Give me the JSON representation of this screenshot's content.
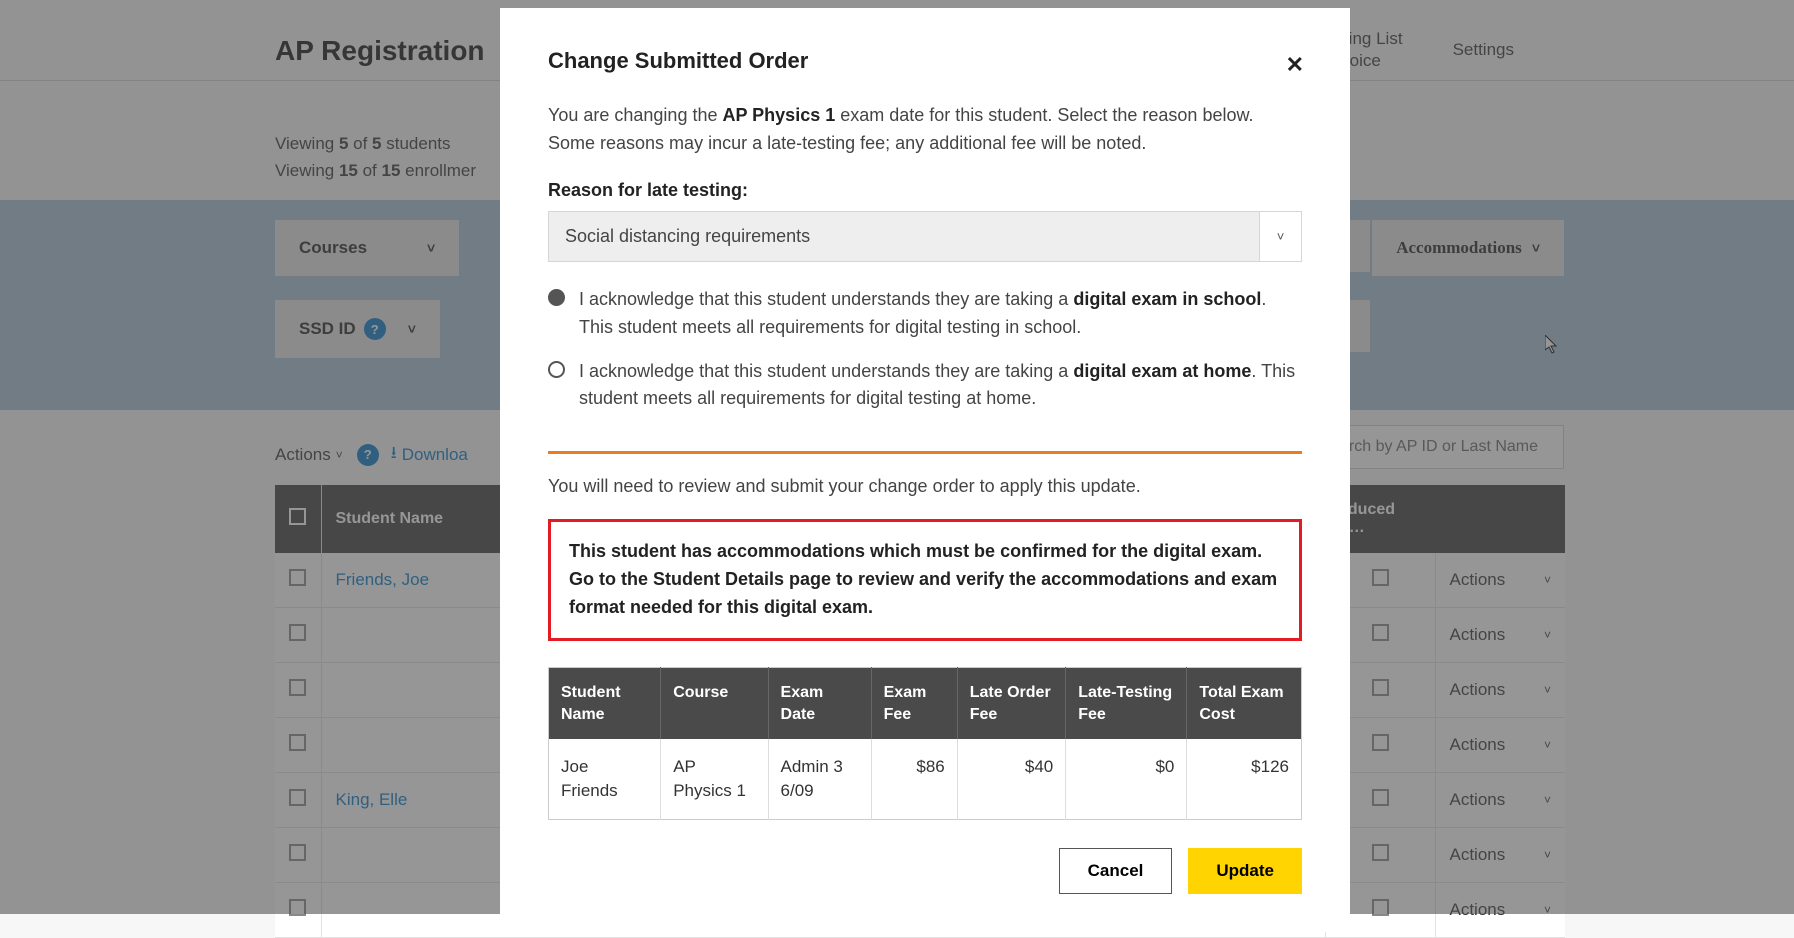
{
  "page": {
    "title": "AP Registration",
    "nav": {
      "packing": "Packing List\n& Invoice",
      "settings": "Settings"
    },
    "viewing_students": "Viewing <b>5</b> of <b>5</b> students",
    "viewing_enroll": "Viewing <b>15</b> of <b>15</b> enrollmer"
  },
  "filters": {
    "courses": "Courses",
    "accommodations": "Accommodations",
    "ssd": "SSD ID"
  },
  "actions_bar": {
    "actions": "Actions",
    "download": "Downloa"
  },
  "search_placeholder": "arch by AP ID or Last Name",
  "roster": {
    "columns": {
      "name": "Student Name",
      "reduced": "educed F…"
    },
    "action_label": "Actions",
    "rows": [
      {
        "name": "Friends, Joe"
      },
      {
        "name": ""
      },
      {
        "name": ""
      },
      {
        "name": ""
      },
      {
        "name": "King, Elle"
      },
      {
        "name": ""
      },
      {
        "name": ""
      }
    ]
  },
  "modal": {
    "title": "Change Submitted Order",
    "intro_pre": "You are changing the ",
    "intro_course": "AP Physics 1",
    "intro_post": " exam date for this student. Select the reason below. Some reasons may incur a late-testing fee; any additional fee will be noted.",
    "reason_label": "Reason for late testing:",
    "reason_value": "Social distancing requirements",
    "radio1_pre": "I acknowledge that this student understands they are taking a ",
    "radio1_bold": "digital exam in school",
    "radio1_post": ". This student meets all requirements for digital testing in school.",
    "radio2_pre": "I acknowledge that this student understands they are taking a ",
    "radio2_bold": "digital exam at home",
    "radio2_post": ". This student meets all requirements for digital testing at home.",
    "review_note": "You will need to review and submit your change order to apply this update.",
    "accommodation_alert": "This student has accommodations which must be confirmed for the digital exam. Go to the Student Details page to review and verify the accommodations and exam format needed for this digital exam.",
    "cost": {
      "headers": [
        "Student Name",
        "Course",
        "Exam Date",
        "Exam Fee",
        "Late Order Fee",
        "Late-Testing Fee",
        "Total Exam Cost"
      ],
      "row": {
        "student": "Joe Friends",
        "course": "AP Physics 1",
        "date": "Admin 3 6/09",
        "fee": "$86",
        "late_order": "$40",
        "late_testing": "$0",
        "total": "$126"
      }
    },
    "buttons": {
      "cancel": "Cancel",
      "update": "Update"
    }
  }
}
